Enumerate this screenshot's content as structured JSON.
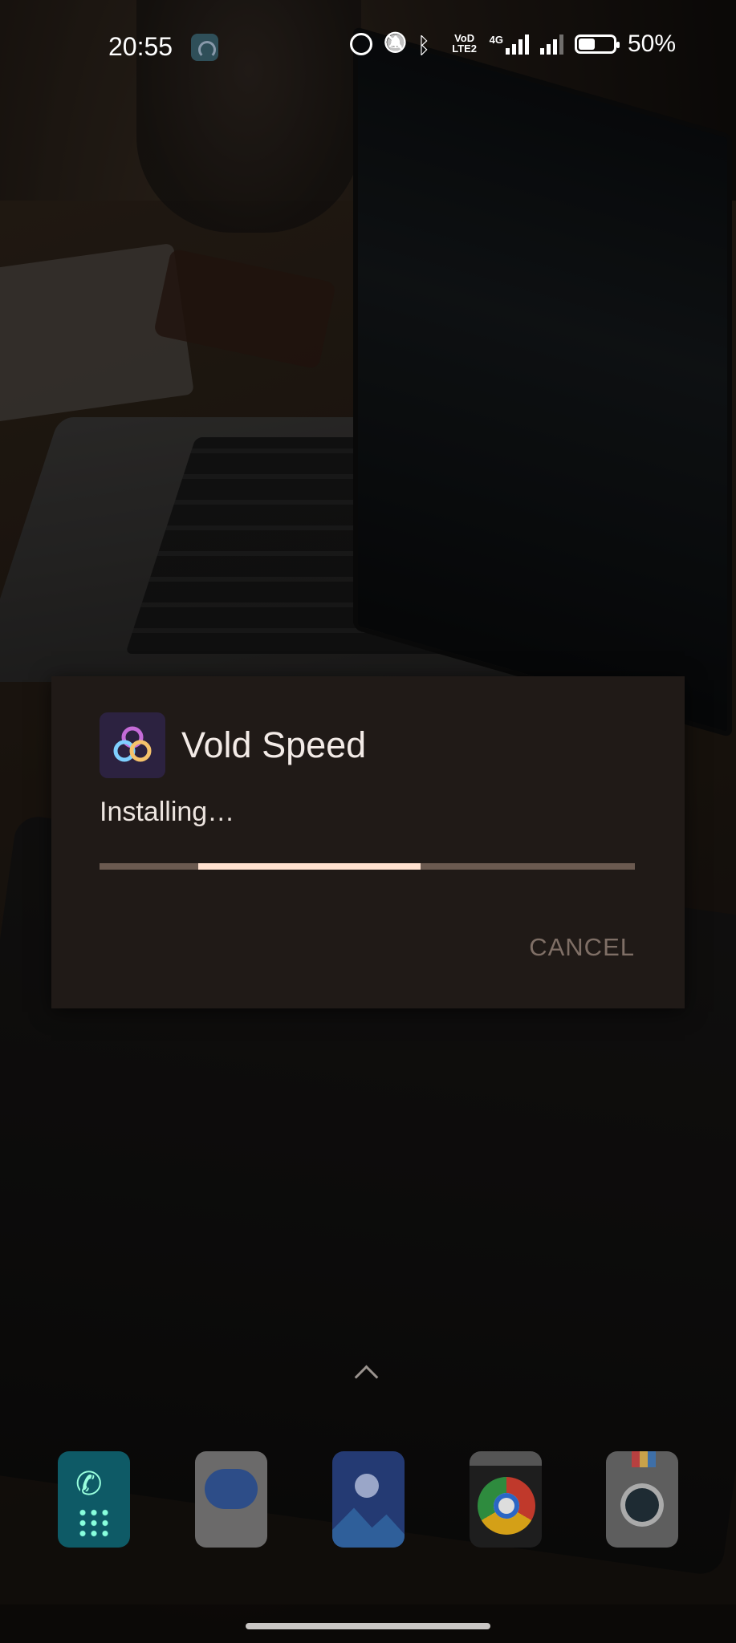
{
  "status_bar": {
    "time": "20:55",
    "network_label": "4G",
    "volte_label": "VoD LTE2",
    "battery_percent": "50%",
    "battery_level": 0.5,
    "icons": [
      "notification-app-icon",
      "alarm-icon",
      "mute-icon",
      "bluetooth-icon",
      "volte-icon",
      "signal-4g-icon",
      "signal-icon",
      "battery-icon"
    ]
  },
  "dialog": {
    "app_name": "Vold Speed",
    "status": "Installing…",
    "cancel_label": "CANCEL",
    "progress": {
      "indeterminate": true,
      "segment_start": 0.185,
      "segment_end": 0.6
    },
    "colors": {
      "background": "#201a17",
      "track": "#6b5a50",
      "bar": "#ffe1cf"
    }
  },
  "home": {
    "app_drawer_hint": "chevron-up-icon"
  },
  "dock": {
    "apps": [
      {
        "name": "Phone",
        "icon": "phone-icon"
      },
      {
        "name": "Messages",
        "icon": "messages-icon"
      },
      {
        "name": "Gallery",
        "icon": "gallery-icon"
      },
      {
        "name": "Chrome",
        "icon": "chrome-icon"
      },
      {
        "name": "Camera",
        "icon": "camera-icon"
      }
    ]
  }
}
